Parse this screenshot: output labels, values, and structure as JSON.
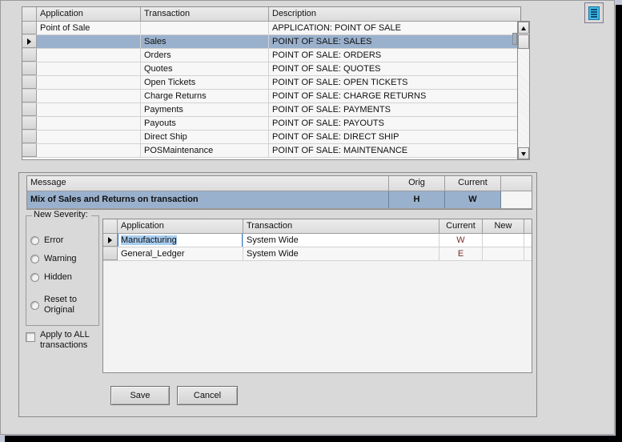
{
  "window": {
    "background_color": "#d9d9d9",
    "desktop_color": "#c3c7da"
  },
  "toolbar": {
    "list_icon": "list-icon"
  },
  "top_grid": {
    "columns": [
      "Application",
      "Transaction",
      "Description"
    ],
    "rows": [
      {
        "selector": "",
        "application": "Point of Sale",
        "transaction": "",
        "description": "APPLICATION: POINT OF SALE",
        "selected": false
      },
      {
        "selector": "arrow",
        "application": "",
        "transaction": "Sales",
        "description": "POINT OF SALE: SALES",
        "selected": true
      },
      {
        "selector": "",
        "application": "",
        "transaction": "Orders",
        "description": "POINT OF SALE: ORDERS",
        "selected": false
      },
      {
        "selector": "",
        "application": "",
        "transaction": "Quotes",
        "description": "POINT OF SALE: QUOTES",
        "selected": false
      },
      {
        "selector": "",
        "application": "",
        "transaction": "Open Tickets",
        "description": "POINT OF SALE: OPEN TICKETS",
        "selected": false
      },
      {
        "selector": "",
        "application": "",
        "transaction": "Charge Returns",
        "description": "POINT OF SALE: CHARGE RETURNS",
        "selected": false
      },
      {
        "selector": "",
        "application": "",
        "transaction": "Payments",
        "description": "POINT OF SALE: PAYMENTS",
        "selected": false
      },
      {
        "selector": "",
        "application": "",
        "transaction": "Payouts",
        "description": "POINT OF SALE: PAYOUTS",
        "selected": false
      },
      {
        "selector": "",
        "application": "",
        "transaction": "Direct Ship",
        "description": "POINT OF SALE: DIRECT SHIP",
        "selected": false
      },
      {
        "selector": "",
        "application": "",
        "transaction": "POSMaintenance",
        "description": "POINT OF SALE: MAINTENANCE",
        "selected": false
      }
    ],
    "scrollbar": {
      "up_arrow": "▲",
      "down_arrow": "▼"
    }
  },
  "message_grid": {
    "columns": [
      "Message",
      "Orig",
      "Current"
    ],
    "rows": [
      {
        "message": "Mix of Sales and Returns on transaction",
        "orig": "H",
        "current": "W",
        "selected": true
      }
    ]
  },
  "severity": {
    "legend": "New Severity:",
    "options": [
      {
        "label": "Error",
        "selected": false
      },
      {
        "label": "Warning",
        "selected": false
      },
      {
        "label": "Hidden",
        "selected": false
      },
      {
        "label": "Reset to Original",
        "selected": false
      }
    ],
    "apply_all": {
      "label": "Apply to ALL transactions",
      "checked": false
    }
  },
  "lower_grid": {
    "columns": [
      "Application",
      "Transaction",
      "Current",
      "New"
    ],
    "rows": [
      {
        "selector": "arrow",
        "application": "Manufacturing",
        "transaction": "System Wide",
        "current": "W",
        "new": "",
        "editing": true
      },
      {
        "selector": "",
        "application": "General_Ledger",
        "transaction": "System Wide",
        "current": "E",
        "new": "",
        "editing": false
      }
    ]
  },
  "buttons": {
    "save": "Save",
    "cancel": "Cancel"
  },
  "colors": {
    "selection_blue": "#9ab1cd",
    "edit_border_blue": "#2f7fd0",
    "text_selection_blue": "#a8cdf0",
    "value_text": "#7a2e2e",
    "icon_blue": "#3fbdea"
  }
}
